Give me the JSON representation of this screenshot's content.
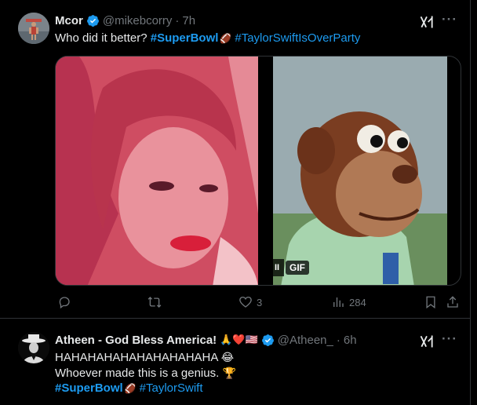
{
  "tweets": [
    {
      "name": "Mcor",
      "handle": "@mikebcorry",
      "separator": "·",
      "time": "7h",
      "text_prefix": "Who did it better? ",
      "hashtag1": "#SuperBowl",
      "hashtag1_emoji": "🏈",
      "hashtag2": "#TaylorSwiftIsOverParty",
      "media": {
        "gif_label": "GIF",
        "pause_symbol": "II"
      },
      "actions": {
        "replies": "",
        "retweets": "",
        "likes": "3",
        "views": "284"
      }
    },
    {
      "name": "Atheen - God Bless America!",
      "name_emojis": "🙏❤️🇺🇸",
      "handle": "@Atheen_",
      "separator": "·",
      "time": "6h",
      "line1": "HAHAHAHAHAHAHAHAHAHA",
      "line1_emoji": "😂",
      "line2": "Whoever made this is a genius.",
      "line2_emoji": "🏆",
      "hashtag1": "#SuperBowl",
      "hashtag1_emoji": "🏈",
      "hashtag2": "#TaylorSwift"
    }
  ],
  "colors": {
    "link": "#1d9bf0",
    "muted": "#71767b",
    "text": "#e7e9ea",
    "background": "#000000"
  }
}
